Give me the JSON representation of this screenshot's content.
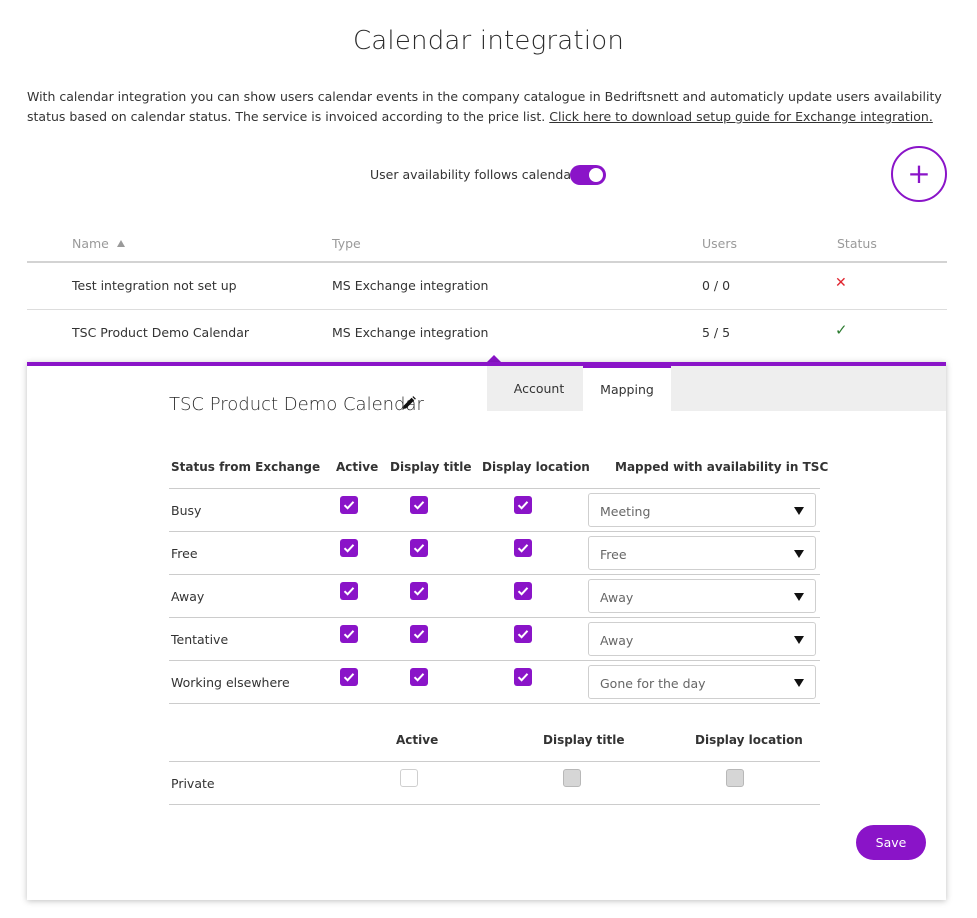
{
  "page": {
    "title": "Calendar integration",
    "intro_text": "With calendar integration you can show users calendar events in the company catalogue in Bedriftsnett and automaticly update users availability status based on calendar status. The service is invoiced according to the price list.",
    "intro_link": "Click here to download setup guide for Exchange integration."
  },
  "availability_toggle": {
    "label": "User availability follows calendar",
    "on": true
  },
  "add_button": {
    "icon": "plus-icon",
    "symbol": "+"
  },
  "integrations_table": {
    "headers": {
      "name": "Name",
      "type": "Type",
      "users": "Users",
      "status": "Status"
    },
    "sort_icon": "sort-up-icon",
    "rows": [
      {
        "name": "Test integration not set up",
        "type": "MS Exchange integration",
        "users": "0 / 0",
        "status": "error",
        "status_symbol": "✕"
      },
      {
        "name": "TSC Product Demo Calendar",
        "type": "MS Exchange integration",
        "users": "5 / 5",
        "status": "ok",
        "status_symbol": "✓"
      }
    ]
  },
  "detail": {
    "name": "TSC Product Demo Calendar",
    "tabs": [
      {
        "label": "Account",
        "active": false
      },
      {
        "label": "Mapping",
        "active": true
      }
    ],
    "mapping": {
      "headers": {
        "status": "Status from Exchange",
        "active": "Active",
        "display_title": "Display title",
        "display_location": "Display location",
        "mapped": "Mapped with availability in TSC"
      },
      "rows": [
        {
          "status": "Busy",
          "active": true,
          "display_title": true,
          "display_location": true,
          "mapped": "Meeting"
        },
        {
          "status": "Free",
          "active": true,
          "display_title": true,
          "display_location": true,
          "mapped": "Free"
        },
        {
          "status": "Away",
          "active": true,
          "display_title": true,
          "display_location": true,
          "mapped": "Away"
        },
        {
          "status": "Tentative",
          "active": true,
          "display_title": true,
          "display_location": true,
          "mapped": "Away"
        },
        {
          "status": "Working elsewhere",
          "active": true,
          "display_title": true,
          "display_location": true,
          "mapped": "Gone for the day"
        }
      ]
    },
    "private": {
      "headers": {
        "active": "Active",
        "display_title": "Display title",
        "display_location": "Display location"
      },
      "label": "Private",
      "active": false,
      "display_title": false,
      "display_location": false
    },
    "save_label": "Save"
  },
  "colors": {
    "accent": "#8a14c8",
    "error": "#e0242f",
    "success": "#2e7d32"
  }
}
